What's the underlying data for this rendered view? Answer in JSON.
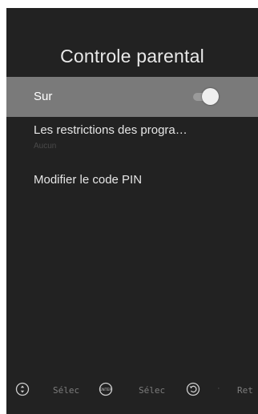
{
  "screen": {
    "title": "Controle parental"
  },
  "menu": {
    "items": [
      {
        "label": "Sur",
        "toggle_on": true,
        "selected": true
      },
      {
        "label": "Les restrictions des progra…",
        "subtitle": "Aucun"
      },
      {
        "label": "Modifier le code PIN"
      }
    ]
  },
  "footer": {
    "hints": [
      {
        "icon": "navigate-icon",
        "label": "Sélec"
      },
      {
        "icon": "enter-icon",
        "icon_text": "ENTER",
        "label": "Sélec"
      },
      {
        "icon": "back-icon",
        "label": "Ret"
      }
    ]
  },
  "colors": {
    "background": "#222222",
    "selected_row": "#7a7a7a",
    "text": "#e6e6e6"
  }
}
